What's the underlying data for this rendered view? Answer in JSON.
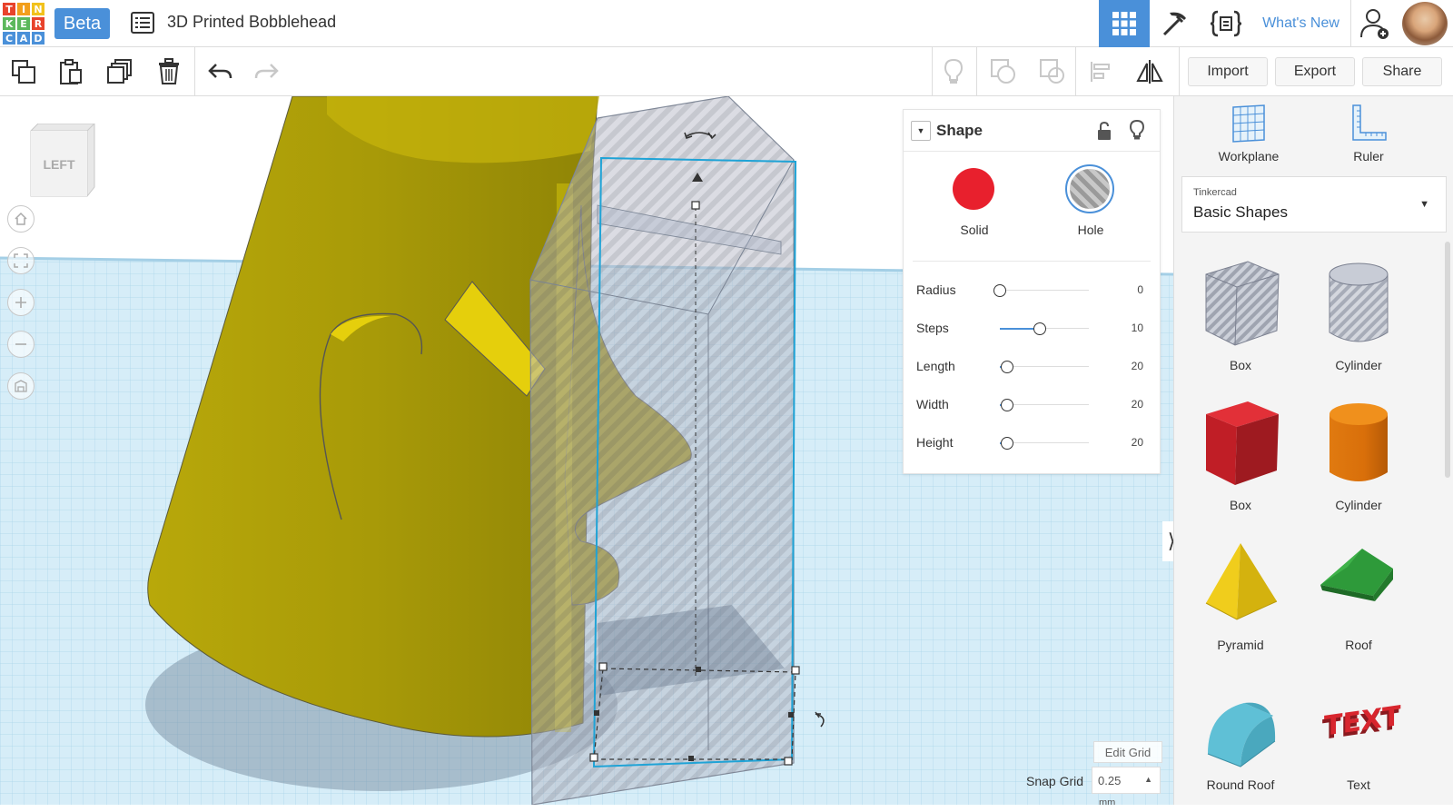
{
  "app": {
    "logo_letters": [
      "T",
      "I",
      "N",
      "K",
      "E",
      "R",
      "C",
      "A",
      "D"
    ],
    "logo_colors": [
      "#e8432c",
      "#f29f1c",
      "#f2c21c",
      "#5cb85c",
      "#5cb85c",
      "#e8432c",
      "#4a90d9",
      "#4a90d9",
      "#4a90d9"
    ],
    "beta_label": "Beta",
    "design_title": "3D Printed Bobblehead",
    "whats_new": "What's New"
  },
  "toolbar": {
    "import_label": "Import",
    "export_label": "Export",
    "share_label": "Share"
  },
  "viewcube": {
    "face": "LEFT"
  },
  "inspector": {
    "title": "Shape",
    "solid_label": "Solid",
    "hole_label": "Hole",
    "selected_mode": "Hole",
    "properties": [
      {
        "label": "Radius",
        "value": "0",
        "level": 0
      },
      {
        "label": "Steps",
        "value": "10",
        "level": 0.45
      },
      {
        "label": "Length",
        "value": "20",
        "level": 0.08
      },
      {
        "label": "Width",
        "value": "20",
        "level": 0.08
      },
      {
        "label": "Height",
        "value": "20",
        "level": 0.08
      }
    ]
  },
  "grid": {
    "edit_grid_label": "Edit Grid",
    "snap_grid_label": "Snap Grid",
    "snap_value": "0.25",
    "snap_unit": "mm"
  },
  "panel": {
    "workplane_label": "Workplane",
    "ruler_label": "Ruler",
    "category_small": "Tinkercad",
    "category_main": "Basic Shapes",
    "shapes": [
      {
        "label": "Box",
        "icon": "box-hole-icon"
      },
      {
        "label": "Cylinder",
        "icon": "cylinder-hole-icon"
      },
      {
        "label": "Box",
        "icon": "box-solid-icon"
      },
      {
        "label": "Cylinder",
        "icon": "cylinder-solid-icon"
      },
      {
        "label": "Pyramid",
        "icon": "pyramid-icon"
      },
      {
        "label": "Roof",
        "icon": "roof-icon"
      },
      {
        "label": "Round Roof",
        "icon": "round-roof-icon"
      },
      {
        "label": "Text",
        "icon": "text-shape-icon"
      }
    ]
  },
  "colors": {
    "accent": "#4a90d9",
    "solid_red": "#e8202d",
    "model_yellow": "#a89c0a",
    "grid_blue": "#c8e6f4"
  }
}
